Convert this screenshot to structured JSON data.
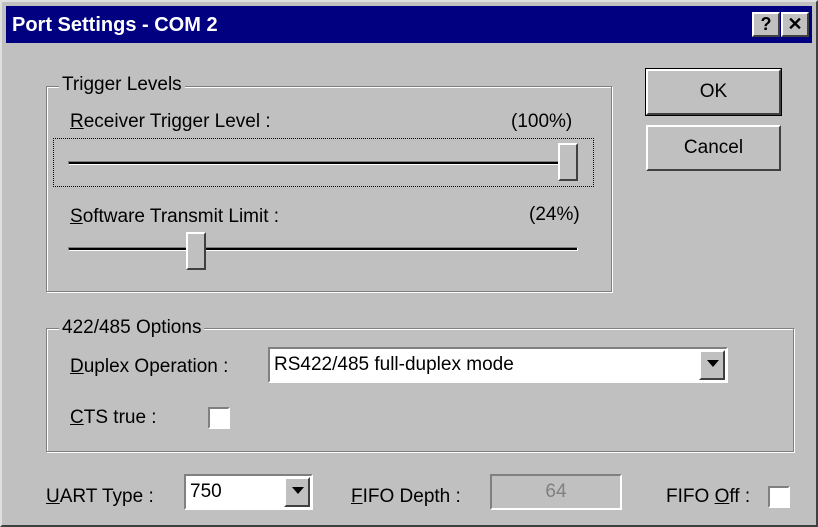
{
  "window": {
    "title": "Port Settings - COM 2",
    "help_glyph": "?",
    "close_glyph": "✕"
  },
  "trigger_levels": {
    "legend": "Trigger Levels",
    "receiver": {
      "label_accel": "R",
      "label_rest": "eceiver Trigger Level :",
      "value_text": "(100%)",
      "level": 1.0
    },
    "transmit": {
      "label_accel": "S",
      "label_rest": "oftware Transmit Limit :",
      "value_text": "(24%)",
      "level": 0.24
    }
  },
  "buttons": {
    "ok": "OK",
    "cancel": "Cancel"
  },
  "options_422_485": {
    "legend": "422/485 Options",
    "duplex": {
      "label_accel": "D",
      "label_rest": "uplex Operation :",
      "value": "RS422/485 full-duplex mode"
    },
    "cts": {
      "label_accel": "C",
      "label_rest": "TS true :",
      "checked": false
    }
  },
  "uart": {
    "label_accel": "U",
    "label_rest": "ART Type :",
    "value": "750"
  },
  "fifo_depth": {
    "label_accel": "F",
    "label_rest": "IFO Depth :",
    "value": "64"
  },
  "fifo_off": {
    "label_pre": "FIFO ",
    "label_accel": "O",
    "label_rest": "ff :",
    "checked": false
  }
}
